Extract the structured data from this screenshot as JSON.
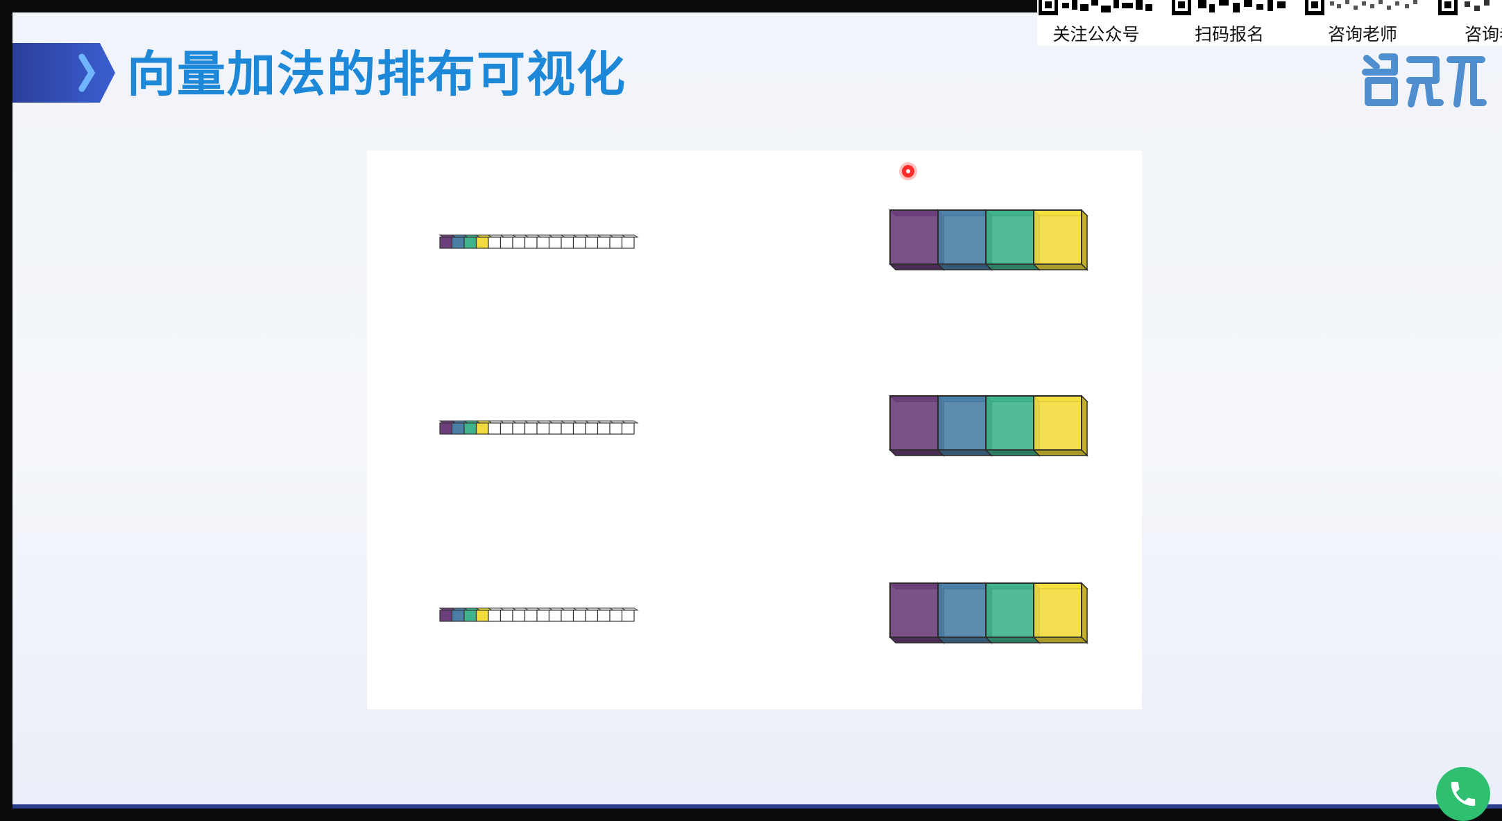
{
  "slide": {
    "title": "向量加法的排布可视化"
  },
  "qr_panel": {
    "items": [
      {
        "label": "关注公众号"
      },
      {
        "label": "扫码报名"
      },
      {
        "label": "咨询老师"
      },
      {
        "label": "咨询老"
      }
    ]
  },
  "figure": {
    "rows": 3,
    "strip_cells": 16,
    "colored_cells": 4,
    "cube_count": 4,
    "colors": [
      "#6b3f7a",
      "#4b7fa6",
      "#3fb38a",
      "#f2dc3c"
    ]
  },
  "icons": {
    "title_decoration": "chevron-icon",
    "logo": "brand-logo",
    "call": "phone-icon",
    "pointer": "laser-pointer"
  }
}
